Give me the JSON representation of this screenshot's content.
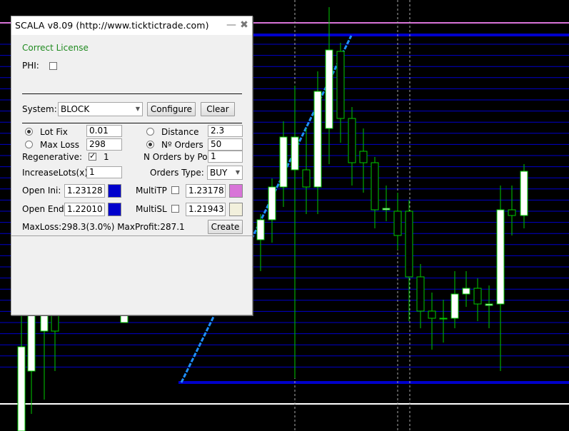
{
  "window": {
    "title": "SCALA v8.09 (http://www.ticktictrade.com)",
    "minimize_icon": "minimize-icon",
    "close_icon": "close-icon"
  },
  "license": {
    "text": "Correct License",
    "color": "#1f8a1f"
  },
  "phi": {
    "label": "PHI:",
    "checked": false
  },
  "system": {
    "label": "System:",
    "selected": "BLOCK",
    "configure_label": "Configure",
    "clear_label": "Clear"
  },
  "sizing": {
    "lot_fix": {
      "label": "Lot Fix",
      "value": "0.01",
      "selected": true
    },
    "max_loss": {
      "label": "Max Loss",
      "value": "298",
      "selected": false
    },
    "distance": {
      "label": "Distance",
      "value": "2.3",
      "selected": false
    },
    "n_orders": {
      "label": "Nº Orders",
      "value": "50",
      "selected": true
    }
  },
  "regenerative": {
    "label": "Regenerative:",
    "checked": true,
    "value": "1"
  },
  "n_orders_by_pos": {
    "label": "N Orders by Pos",
    "value": "1"
  },
  "increase_lots": {
    "label": "IncreaseLots(x)",
    "value": "1"
  },
  "orders_type": {
    "label": "Orders Type:",
    "selected": "BUY"
  },
  "open_ini": {
    "label": "Open Ini:",
    "value": "1.23128",
    "color": "#0000cc"
  },
  "open_end": {
    "label": "Open End:",
    "value": "1.22010",
    "color": "#0000cc"
  },
  "multi_tp": {
    "label": "MultiTP",
    "checked": false,
    "value": "1.23178",
    "color": "#d874d8"
  },
  "multi_sl": {
    "label": "MultiSL",
    "checked": false,
    "value": "1.21943",
    "color": "#f2f0dc"
  },
  "summary": {
    "text": "MaxLoss:298.3(3.0%) MaxProfit:287.1"
  },
  "create_label": "Create",
  "chart_colors": {
    "background": "#000000",
    "grid_level": "#0000cc",
    "bold_level": "#0000cc",
    "top_level": "#d874d8",
    "bottom_level": "#ffffff",
    "candle_outline": "#00cc00",
    "bull_body": "#ffffff",
    "bear_body": "#000000",
    "trendline": "#1e90ff"
  }
}
